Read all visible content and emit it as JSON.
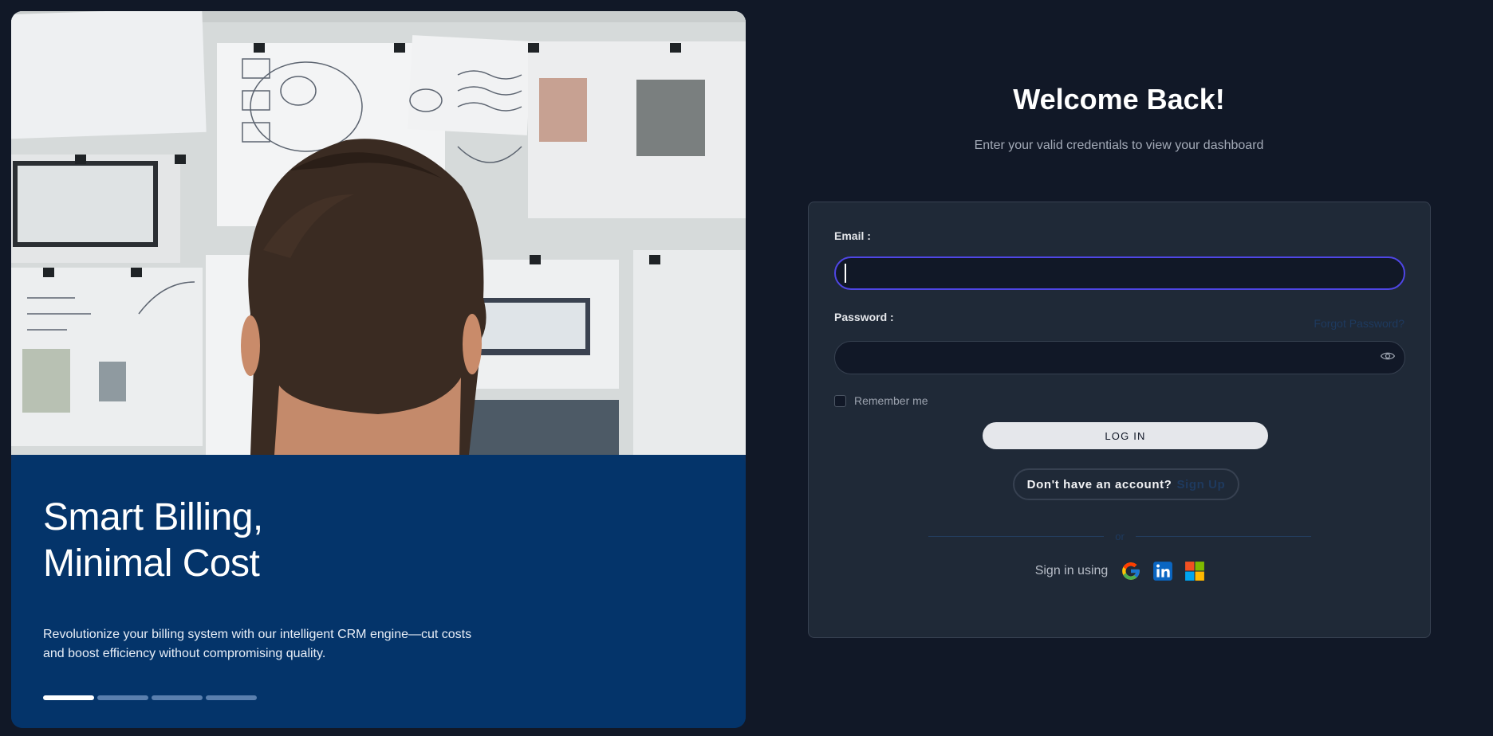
{
  "hero": {
    "title_line1": "Smart Billing,",
    "title_line2": "Minimal Cost",
    "description": "Revolutionize your billing system with our intelligent CRM engine—cut costs and boost efficiency without compromising quality.",
    "slides": [
      {
        "active": true
      },
      {
        "active": false
      },
      {
        "active": false
      },
      {
        "active": false
      }
    ]
  },
  "login": {
    "title": "Welcome Back!",
    "subtitle": "Enter your valid credentials to view your dashboard",
    "email_label": "Email :",
    "email_value": "",
    "password_label": "Password :",
    "password_value": "",
    "forgot_link": "Forgot Password?",
    "remember_label": "Remember me",
    "remember_checked": false,
    "login_button": "LOG IN",
    "no_account_text": "Don't have an account?",
    "signup_link": "Sign Up",
    "divider_text": "or",
    "social_label": "Sign in using",
    "social_icons": [
      "google-icon",
      "linkedin-icon",
      "microsoft-icon"
    ]
  },
  "colors": {
    "background": "#111827",
    "hero_panel": "#04346a",
    "card": "#1f2937",
    "focus_ring": "#4f46e5",
    "link": "#1e3a5f"
  }
}
